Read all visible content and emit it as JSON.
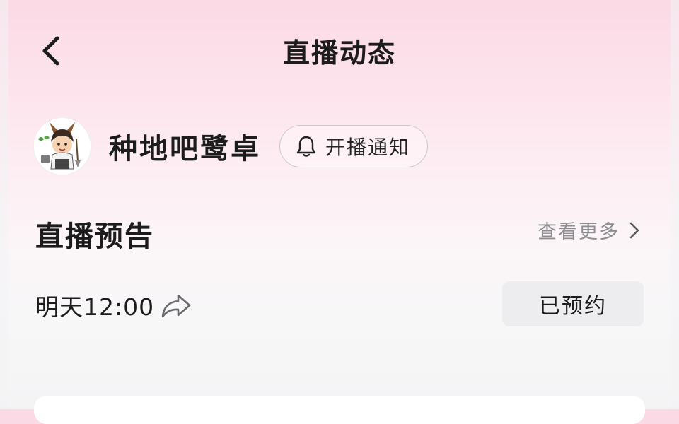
{
  "header": {
    "title": "直播动态",
    "back_icon": "chevron-left-icon"
  },
  "streamer": {
    "name": "种地吧鹭卓",
    "avatar_icon": "cartoon-avatar",
    "notify_button_label": "开播通知",
    "notify_icon": "bell-icon"
  },
  "preview_section": {
    "title": "直播预告",
    "see_more_label": "查看更多",
    "see_more_icon": "chevron-right-icon"
  },
  "schedule": {
    "time": "明天12:00",
    "share_icon": "share-arrow-icon",
    "booked_label": "已预约"
  },
  "colors": {
    "bg_top": "#fbd9e5",
    "bg_bottom": "#f4f4f5",
    "booked_bg": "#ededef",
    "secondary_text": "#8d8d92"
  }
}
